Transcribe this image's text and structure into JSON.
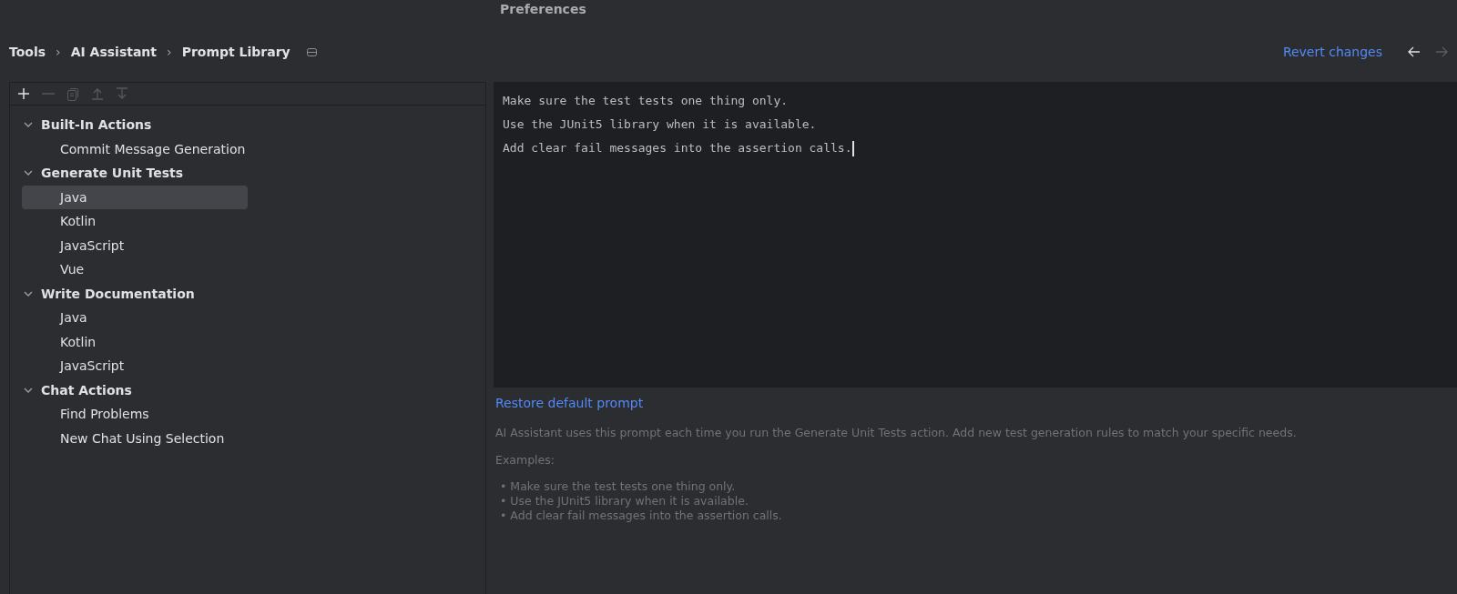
{
  "window": {
    "title": "Preferences"
  },
  "breadcrumb": {
    "items": [
      "Tools",
      "AI Assistant",
      "Prompt Library"
    ],
    "separator": "›"
  },
  "revert_link": "Revert changes",
  "nav": [
    {
      "kind": "back",
      "disabled": false
    },
    {
      "kind": "forward",
      "disabled": true
    }
  ],
  "toolbar": [
    {
      "kind": "add",
      "disabled": false
    },
    {
      "kind": "remove",
      "disabled": true
    },
    {
      "kind": "copy",
      "disabled": true
    },
    {
      "kind": "up",
      "disabled": true
    },
    {
      "kind": "down",
      "disabled": true
    }
  ],
  "tree": [
    {
      "label": "Built-In Actions",
      "expanded": true,
      "children": [
        {
          "label": "Commit Message Generation",
          "selected": false
        }
      ]
    },
    {
      "label": "Generate Unit Tests",
      "expanded": true,
      "children": [
        {
          "label": "Java",
          "selected": true
        },
        {
          "label": "Kotlin",
          "selected": false
        },
        {
          "label": "JavaScript",
          "selected": false
        },
        {
          "label": "Vue",
          "selected": false
        }
      ]
    },
    {
      "label": "Write Documentation",
      "expanded": true,
      "children": [
        {
          "label": "Java",
          "selected": false
        },
        {
          "label": "Kotlin",
          "selected": false
        },
        {
          "label": "JavaScript",
          "selected": false
        }
      ]
    },
    {
      "label": "Chat Actions",
      "expanded": true,
      "children": [
        {
          "label": "Find Problems",
          "selected": false
        },
        {
          "label": "New Chat Using Selection",
          "selected": false
        }
      ]
    }
  ],
  "editor": {
    "lines": [
      "Make sure the test tests one thing only.",
      "Use the JUnit5 library when it is available.",
      "Add clear fail messages into the assertion calls."
    ]
  },
  "restore_link": "Restore default prompt",
  "description": "AI Assistant uses this prompt each time you run the Generate Unit Tests action. Add new test generation rules to match your specific needs.",
  "examples": {
    "heading": "Examples:",
    "bullet": "•",
    "items": [
      "Make sure the test tests one thing only.",
      "Use the JUnit5 library when it is available.",
      "Add clear fail messages into the assertion calls."
    ]
  }
}
